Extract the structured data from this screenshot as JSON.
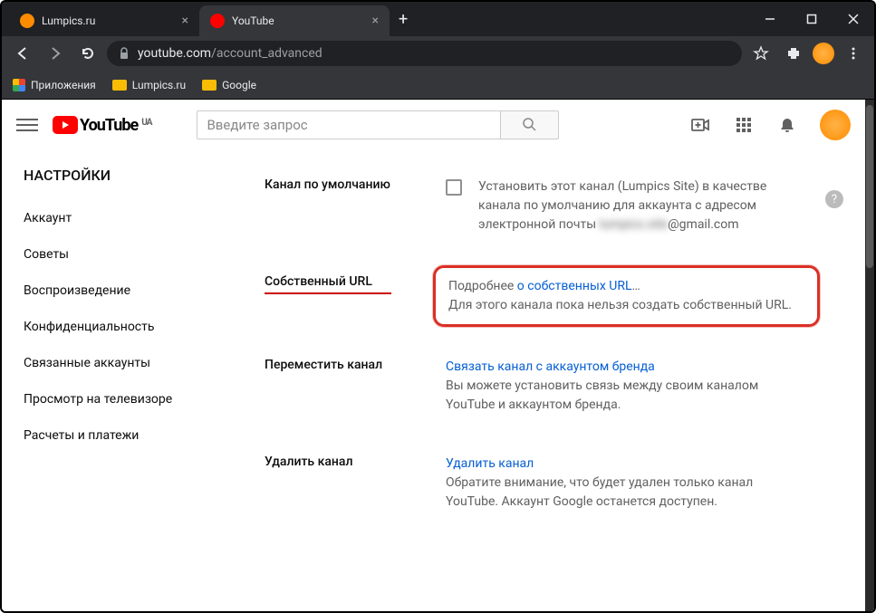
{
  "tabs": [
    {
      "title": "Lumpics.ru",
      "active": false,
      "favicon": "#ff8c00"
    },
    {
      "title": "YouTube",
      "active": true,
      "favicon": "#ff0000"
    }
  ],
  "url": {
    "host": "youtube.com",
    "path": "/account_advanced"
  },
  "bookmarks": {
    "apps": "Приложения",
    "l1": "Lumpics.ru",
    "l2": "Google"
  },
  "ytlogo": {
    "text": "YouTube",
    "sup": "UA"
  },
  "search": {
    "placeholder": "Введите запрос"
  },
  "sidebar": {
    "title": "НАСТРОЙКИ",
    "items": [
      "Аккаунт",
      "Советы",
      "Воспроизведение",
      "Конфиденциальность",
      "Связанные аккаунты",
      "Просмотр на телевизоре",
      "Расчеты и платежи"
    ]
  },
  "rows": {
    "default": {
      "label": "Канал по умолчанию",
      "text": "Установить этот канал (Lumpics Site) в качестве канала по умолчанию для аккаунта с адресом электронной почты",
      "email_blur": "lumpics.site",
      "email_tail": "@gmail.com"
    },
    "customurl": {
      "label": "Собственный URL",
      "pre": "Подробнее ",
      "link": "о собственных URL",
      "post": "…",
      "desc": "Для этого канала пока нельзя создать собственный URL."
    },
    "move": {
      "label": "Переместить канал",
      "link": "Связать канал с аккаунтом бренда",
      "desc": "Вы можете установить связь между своим каналом YouTube и аккаунтом бренда."
    },
    "delete": {
      "label": "Удалить канал",
      "link": "Удалить канал",
      "desc": "Обратите внимание, что будет удален только канал YouTube. Аккаунт Google останется доступен."
    }
  }
}
